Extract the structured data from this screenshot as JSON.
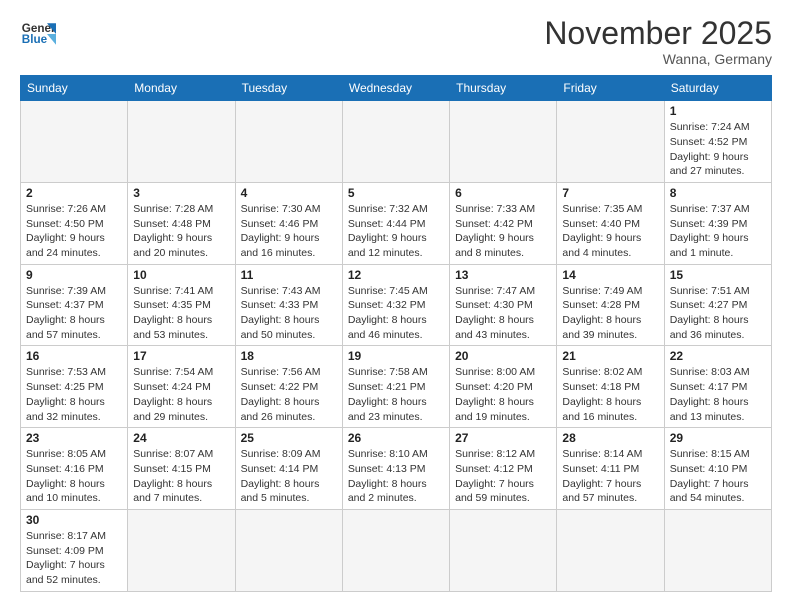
{
  "header": {
    "logo_general": "General",
    "logo_blue": "Blue",
    "month_title": "November 2025",
    "location": "Wanna, Germany"
  },
  "days_of_week": [
    "Sunday",
    "Monday",
    "Tuesday",
    "Wednesday",
    "Thursday",
    "Friday",
    "Saturday"
  ],
  "weeks": [
    [
      {
        "day": "",
        "info": ""
      },
      {
        "day": "",
        "info": ""
      },
      {
        "day": "",
        "info": ""
      },
      {
        "day": "",
        "info": ""
      },
      {
        "day": "",
        "info": ""
      },
      {
        "day": "",
        "info": ""
      },
      {
        "day": "1",
        "info": "Sunrise: 7:24 AM\nSunset: 4:52 PM\nDaylight: 9 hours\nand 27 minutes."
      }
    ],
    [
      {
        "day": "2",
        "info": "Sunrise: 7:26 AM\nSunset: 4:50 PM\nDaylight: 9 hours\nand 24 minutes."
      },
      {
        "day": "3",
        "info": "Sunrise: 7:28 AM\nSunset: 4:48 PM\nDaylight: 9 hours\nand 20 minutes."
      },
      {
        "day": "4",
        "info": "Sunrise: 7:30 AM\nSunset: 4:46 PM\nDaylight: 9 hours\nand 16 minutes."
      },
      {
        "day": "5",
        "info": "Sunrise: 7:32 AM\nSunset: 4:44 PM\nDaylight: 9 hours\nand 12 minutes."
      },
      {
        "day": "6",
        "info": "Sunrise: 7:33 AM\nSunset: 4:42 PM\nDaylight: 9 hours\nand 8 minutes."
      },
      {
        "day": "7",
        "info": "Sunrise: 7:35 AM\nSunset: 4:40 PM\nDaylight: 9 hours\nand 4 minutes."
      },
      {
        "day": "8",
        "info": "Sunrise: 7:37 AM\nSunset: 4:39 PM\nDaylight: 9 hours\nand 1 minute."
      }
    ],
    [
      {
        "day": "9",
        "info": "Sunrise: 7:39 AM\nSunset: 4:37 PM\nDaylight: 8 hours\nand 57 minutes."
      },
      {
        "day": "10",
        "info": "Sunrise: 7:41 AM\nSunset: 4:35 PM\nDaylight: 8 hours\nand 53 minutes."
      },
      {
        "day": "11",
        "info": "Sunrise: 7:43 AM\nSunset: 4:33 PM\nDaylight: 8 hours\nand 50 minutes."
      },
      {
        "day": "12",
        "info": "Sunrise: 7:45 AM\nSunset: 4:32 PM\nDaylight: 8 hours\nand 46 minutes."
      },
      {
        "day": "13",
        "info": "Sunrise: 7:47 AM\nSunset: 4:30 PM\nDaylight: 8 hours\nand 43 minutes."
      },
      {
        "day": "14",
        "info": "Sunrise: 7:49 AM\nSunset: 4:28 PM\nDaylight: 8 hours\nand 39 minutes."
      },
      {
        "day": "15",
        "info": "Sunrise: 7:51 AM\nSunset: 4:27 PM\nDaylight: 8 hours\nand 36 minutes."
      }
    ],
    [
      {
        "day": "16",
        "info": "Sunrise: 7:53 AM\nSunset: 4:25 PM\nDaylight: 8 hours\nand 32 minutes."
      },
      {
        "day": "17",
        "info": "Sunrise: 7:54 AM\nSunset: 4:24 PM\nDaylight: 8 hours\nand 29 minutes."
      },
      {
        "day": "18",
        "info": "Sunrise: 7:56 AM\nSunset: 4:22 PM\nDaylight: 8 hours\nand 26 minutes."
      },
      {
        "day": "19",
        "info": "Sunrise: 7:58 AM\nSunset: 4:21 PM\nDaylight: 8 hours\nand 23 minutes."
      },
      {
        "day": "20",
        "info": "Sunrise: 8:00 AM\nSunset: 4:20 PM\nDaylight: 8 hours\nand 19 minutes."
      },
      {
        "day": "21",
        "info": "Sunrise: 8:02 AM\nSunset: 4:18 PM\nDaylight: 8 hours\nand 16 minutes."
      },
      {
        "day": "22",
        "info": "Sunrise: 8:03 AM\nSunset: 4:17 PM\nDaylight: 8 hours\nand 13 minutes."
      }
    ],
    [
      {
        "day": "23",
        "info": "Sunrise: 8:05 AM\nSunset: 4:16 PM\nDaylight: 8 hours\nand 10 minutes."
      },
      {
        "day": "24",
        "info": "Sunrise: 8:07 AM\nSunset: 4:15 PM\nDaylight: 8 hours\nand 7 minutes."
      },
      {
        "day": "25",
        "info": "Sunrise: 8:09 AM\nSunset: 4:14 PM\nDaylight: 8 hours\nand 5 minutes."
      },
      {
        "day": "26",
        "info": "Sunrise: 8:10 AM\nSunset: 4:13 PM\nDaylight: 8 hours\nand 2 minutes."
      },
      {
        "day": "27",
        "info": "Sunrise: 8:12 AM\nSunset: 4:12 PM\nDaylight: 7 hours\nand 59 minutes."
      },
      {
        "day": "28",
        "info": "Sunrise: 8:14 AM\nSunset: 4:11 PM\nDaylight: 7 hours\nand 57 minutes."
      },
      {
        "day": "29",
        "info": "Sunrise: 8:15 AM\nSunset: 4:10 PM\nDaylight: 7 hours\nand 54 minutes."
      }
    ],
    [
      {
        "day": "30",
        "info": "Sunrise: 8:17 AM\nSunset: 4:09 PM\nDaylight: 7 hours\nand 52 minutes."
      },
      {
        "day": "",
        "info": ""
      },
      {
        "day": "",
        "info": ""
      },
      {
        "day": "",
        "info": ""
      },
      {
        "day": "",
        "info": ""
      },
      {
        "day": "",
        "info": ""
      },
      {
        "day": "",
        "info": ""
      }
    ]
  ]
}
